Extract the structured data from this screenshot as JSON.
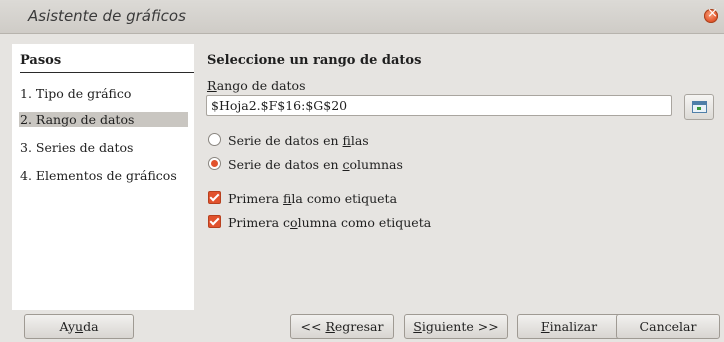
{
  "window": {
    "title": "Asistente de gráficos"
  },
  "steps": {
    "title": "Pasos",
    "items": [
      {
        "label": "1. Tipo de gráfico"
      },
      {
        "label": "2. Rango de datos"
      },
      {
        "label": "3. Series de datos"
      },
      {
        "label": "4. Elementos de gráficos"
      }
    ],
    "selected_index": 1
  },
  "content": {
    "heading": "Seleccione un rango de datos",
    "range_label_first": "R",
    "range_label_rest": "ango de datos",
    "range_value": "$Hoja2.$F$16:$G$20",
    "radio_rows": {
      "before": "Serie de datos en ",
      "mnemonic": "f",
      "after": "ilas",
      "selected": false
    },
    "radio_cols": {
      "before": "Serie de datos en ",
      "mnemonic": "c",
      "after": "olumnas",
      "selected": true
    },
    "check_first_row": {
      "before": "Primera ",
      "mnemonic": "f",
      "after": "ila como etiqueta",
      "checked": true
    },
    "check_first_col": {
      "before": "Primera c",
      "mnemonic": "o",
      "after": "lumna como etiqueta",
      "checked": true
    }
  },
  "buttons": {
    "help": {
      "before": "Ay",
      "mnemonic": "u",
      "after": "da"
    },
    "back": {
      "before": "<< ",
      "mnemonic": "R",
      "after": "egresar"
    },
    "next": {
      "before": "",
      "mnemonic": "S",
      "after": "iguiente >>"
    },
    "finish": {
      "before": "",
      "mnemonic": "F",
      "after": "inalizar"
    },
    "cancel": {
      "label": "Cancelar"
    }
  },
  "colors": {
    "accent": "#e1522d",
    "selection": "#c9c6c1",
    "background": "#e6e4e1"
  }
}
